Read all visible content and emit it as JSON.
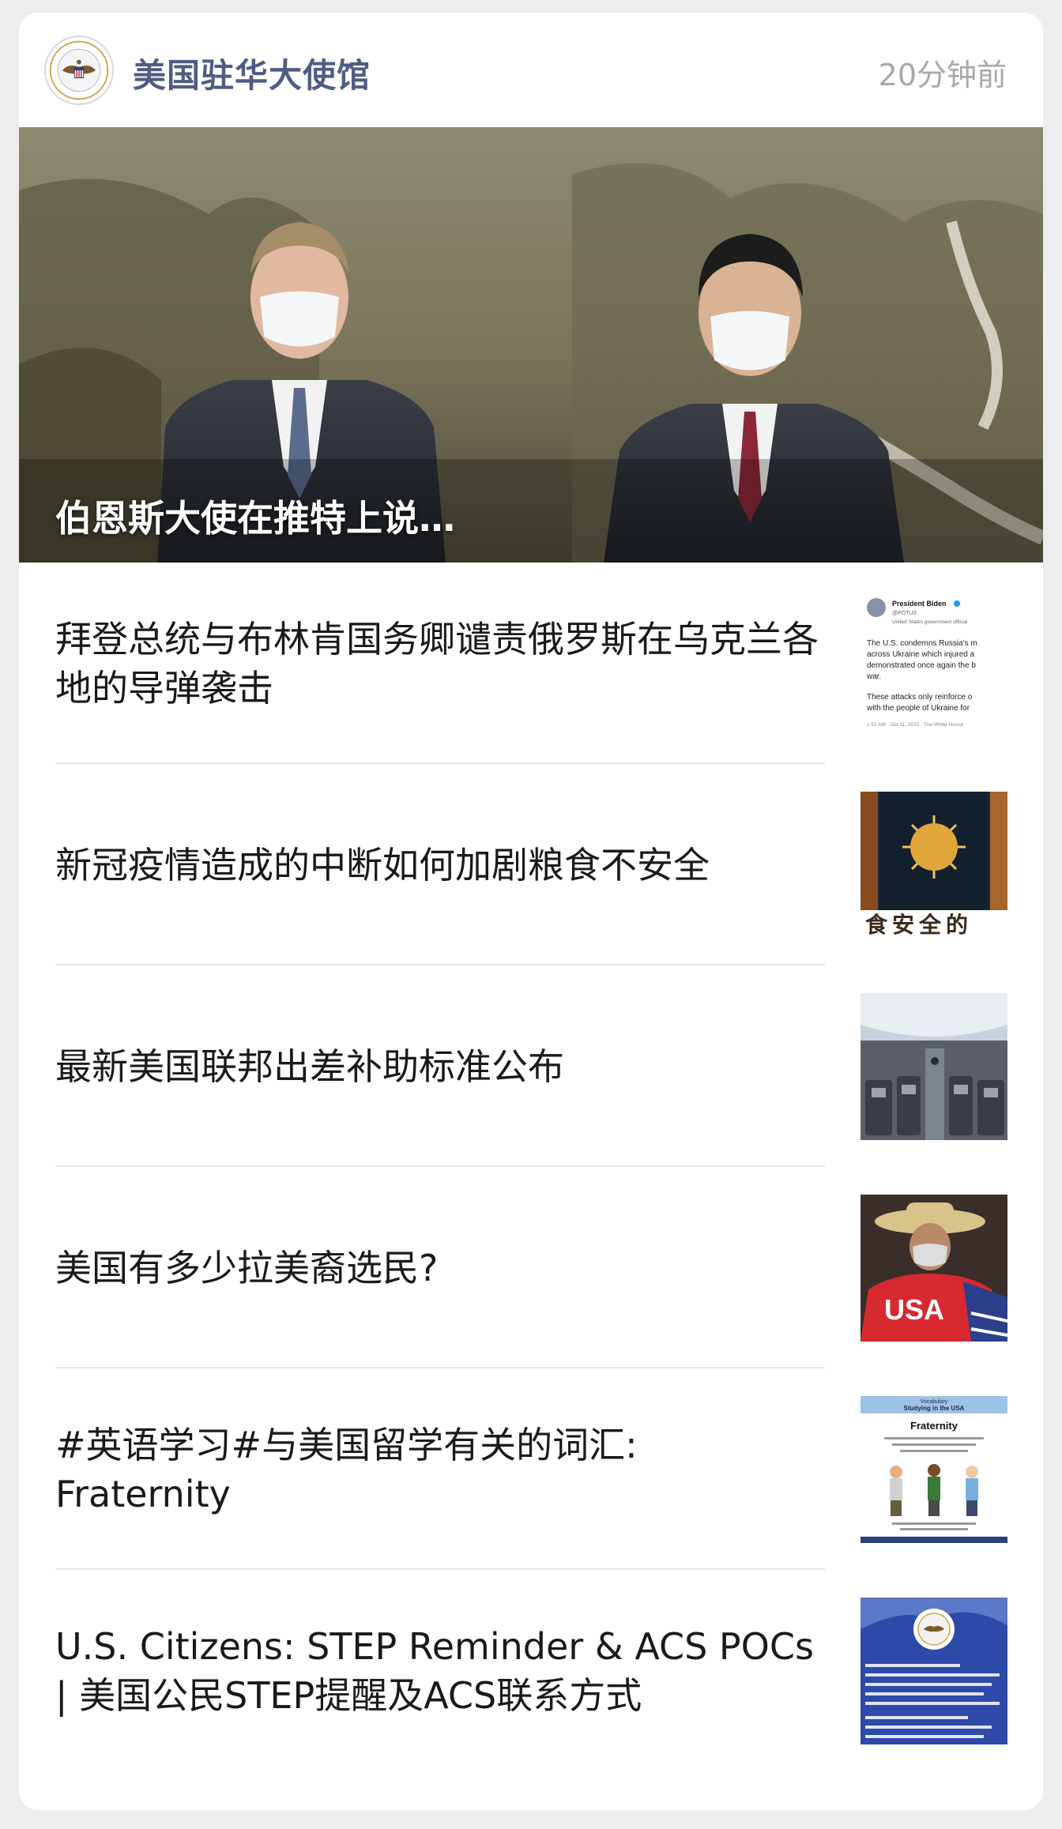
{
  "header": {
    "account_name": "美国驻华大使馆",
    "time": "20分钟前",
    "avatar_icon": "us-embassy-seal-icon"
  },
  "hero": {
    "title": "伯恩斯大使在推特上说…"
  },
  "articles": [
    {
      "title": "拜登总统与布林肯国务卿谴责俄罗斯在乌克兰各地的导弹袭击",
      "thumb_lines": [
        "President Biden",
        "@POTUS",
        "United States government official",
        "The U.S. condemns Russia's m",
        "across Ukraine which injured a",
        "demonstrated once again the b",
        "war.",
        "These attacks only reinforce o",
        "with the people of Ukraine for",
        "1:51 AM · Oct 11, 2022 · The White House"
      ]
    },
    {
      "title": "新冠疫情造成的中断如何加剧粮食不安全",
      "thumb_lines": [
        "食安全的"
      ]
    },
    {
      "title": "最新美国联邦出差补助标准公布",
      "thumb_lines": []
    },
    {
      "title": "美国有多少拉美裔选民?",
      "thumb_lines": [
        "USA"
      ]
    },
    {
      "title": "#英语学习#与美国留学有关的词汇:\nFraternity",
      "thumb_lines": [
        "Vocabulary",
        "Studying in the USA",
        "Fraternity"
      ]
    },
    {
      "title": "U.S. Citizens: STEP Reminder & ACS POCs | 美国公民STEP提醒及ACS联系方式",
      "thumb_lines": []
    }
  ]
}
